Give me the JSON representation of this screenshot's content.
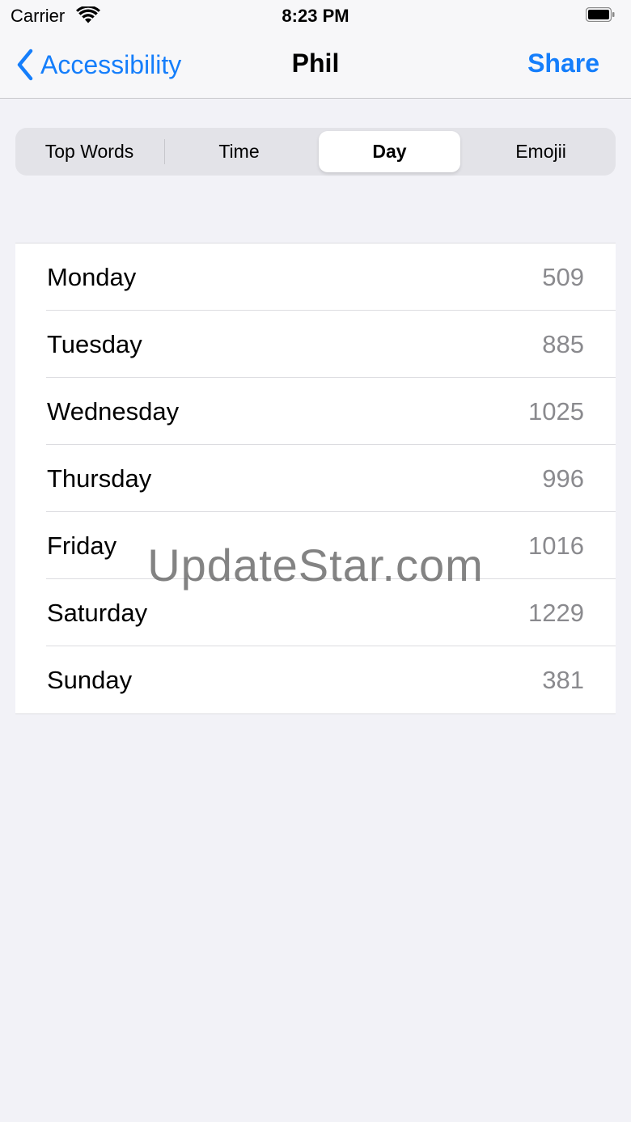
{
  "status_bar": {
    "carrier": "Carrier",
    "time": "8:23 PM",
    "wifi_icon": "wifi-icon",
    "battery_icon": "battery-icon"
  },
  "nav": {
    "back_label": "Accessibility",
    "back_icon": "chevron-left-icon",
    "title": "Phil",
    "share_label": "Share",
    "accent_color": "#157efb"
  },
  "segments": [
    {
      "label": "Top Words",
      "selected": false
    },
    {
      "label": "Time",
      "selected": false
    },
    {
      "label": "Day",
      "selected": true
    },
    {
      "label": "Emojii",
      "selected": false
    }
  ],
  "days": [
    {
      "day": "Monday",
      "count": "509"
    },
    {
      "day": "Tuesday",
      "count": "885"
    },
    {
      "day": "Wednesday",
      "count": "1025"
    },
    {
      "day": "Thursday",
      "count": "996"
    },
    {
      "day": "Friday",
      "count": "1016"
    },
    {
      "day": "Saturday",
      "count": "1229"
    },
    {
      "day": "Sunday",
      "count": "381"
    }
  ],
  "watermark": "UpdateStar.com"
}
